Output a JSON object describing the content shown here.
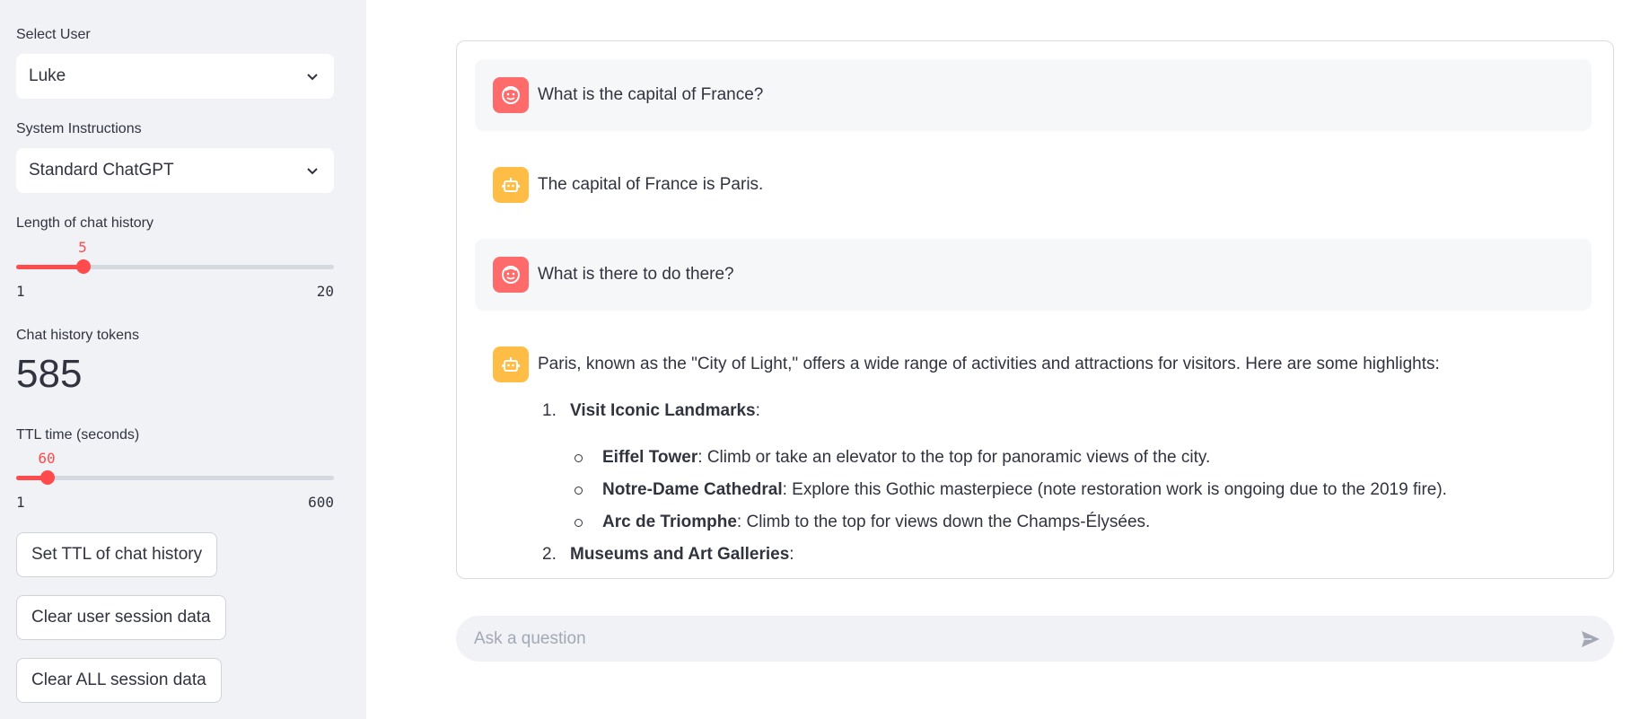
{
  "sidebar": {
    "select_user": {
      "label": "Select User",
      "value": "Luke"
    },
    "system_instructions": {
      "label": "System Instructions",
      "value": "Standard ChatGPT"
    },
    "chat_history_length": {
      "label": "Length of chat history",
      "value": "5",
      "min": "1",
      "max": "20",
      "fraction": 0.2105
    },
    "chat_history_tokens": {
      "label": "Chat history tokens",
      "value": "585"
    },
    "ttl_time": {
      "label": "TTL time (seconds)",
      "value": "60",
      "min": "1",
      "max": "600",
      "fraction": 0.0985
    },
    "buttons": {
      "set_ttl": "Set TTL of chat history",
      "clear_user": "Clear user session data",
      "clear_all": "Clear ALL session data"
    }
  },
  "chat": {
    "messages": [
      {
        "role": "user",
        "text": "What is the capital of France?"
      },
      {
        "role": "assistant",
        "text": "The capital of France is Paris."
      },
      {
        "role": "user",
        "text": "What is there to do there?"
      },
      {
        "role": "assistant",
        "text": "Paris, known as the \"City of Light,\" offers a wide range of activities and attractions for visitors. Here are some highlights:"
      }
    ],
    "list": [
      {
        "num": "1.",
        "title": "Visit Iconic Landmarks",
        "suffix": ":",
        "items": [
          {
            "bold": "Eiffel Tower",
            "rest": ": Climb or take an elevator to the top for panoramic views of the city."
          },
          {
            "bold": "Notre-Dame Cathedral",
            "rest": ": Explore this Gothic masterpiece (note restoration work is ongoing due to the 2019 fire)."
          },
          {
            "bold": "Arc de Triomphe",
            "rest": ": Climb to the top for views down the Champs-Élysées."
          }
        ]
      },
      {
        "num": "2.",
        "title": "Museums and Art Galleries",
        "suffix": ":"
      }
    ]
  },
  "input": {
    "placeholder": "Ask a question"
  },
  "colors": {
    "accent": "#ff4b4b",
    "user_avatar": "#ff6b6b",
    "bot_avatar": "#ffbd45",
    "sidebar_bg": "#f0f2f6"
  },
  "icons": {
    "user_avatar": "smiley-face-icon",
    "bot_avatar": "robot-icon",
    "send": "send-arrow-icon",
    "dropdown": "chevron-down-icon"
  }
}
